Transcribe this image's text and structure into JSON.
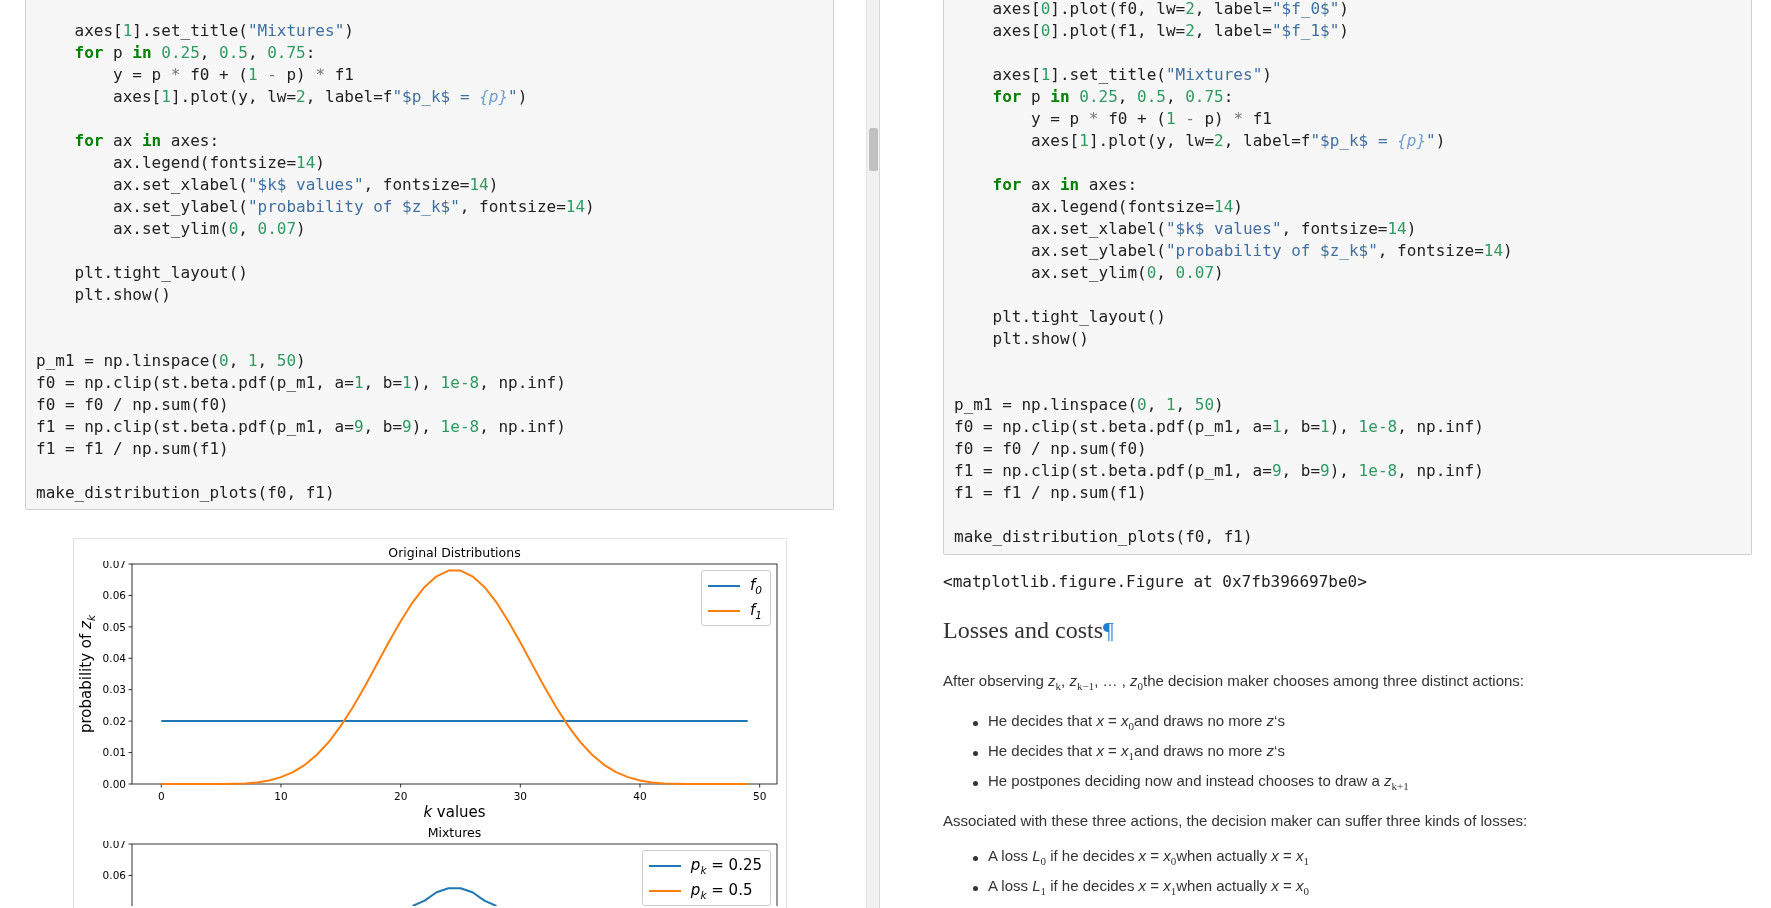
{
  "left_pane": {
    "code_cell": {
      "lines": [
        {
          "kind": "code",
          "tokens": [
            {
              "text": "    axes[",
              "kind": "plain"
            },
            {
              "text": "1",
              "kind": "num"
            },
            {
              "text": "].set_title(",
              "kind": "plain"
            },
            {
              "text": "\"Mixtures\"",
              "kind": "str"
            },
            {
              "text": ")",
              "kind": "plain"
            }
          ]
        },
        {
          "kind": "code",
          "tokens": [
            {
              "text": "    for",
              "kind": "kw"
            },
            {
              "text": " p ",
              "kind": "plain"
            },
            {
              "text": "in",
              "kind": "kw"
            },
            {
              "text": " 0.25",
              "kind": "num"
            },
            {
              "text": ", ",
              "kind": "plain"
            },
            {
              "text": "0.5",
              "kind": "num"
            },
            {
              "text": ", ",
              "kind": "plain"
            },
            {
              "text": "0.75",
              "kind": "num"
            },
            {
              "text": ":",
              "kind": "plain"
            }
          ]
        },
        {
          "kind": "code",
          "tokens": [
            {
              "text": "        y = p ",
              "kind": "plain"
            },
            {
              "text": "*",
              "kind": "op"
            },
            {
              "text": " f0 + (",
              "kind": "plain"
            },
            {
              "text": "1",
              "kind": "num"
            },
            {
              "text": " -",
              "kind": "op"
            },
            {
              "text": " p) ",
              "kind": "plain"
            },
            {
              "text": "*",
              "kind": "op"
            },
            {
              "text": " f1",
              "kind": "plain"
            }
          ]
        },
        {
          "kind": "code",
          "tokens": [
            {
              "text": "        axes[",
              "kind": "plain"
            },
            {
              "text": "1",
              "kind": "num"
            },
            {
              "text": "].plot(y, lw=",
              "kind": "plain"
            },
            {
              "text": "2",
              "kind": "num"
            },
            {
              "text": ", label=f",
              "kind": "plain"
            },
            {
              "text": "\"$p_k$ = ",
              "kind": "str"
            },
            {
              "text": "{p}",
              "kind": "interp"
            },
            {
              "text": "\"",
              "kind": "str"
            },
            {
              "text": ")",
              "kind": "plain"
            }
          ]
        },
        {
          "kind": "blank"
        },
        {
          "kind": "code",
          "tokens": [
            {
              "text": "    for",
              "kind": "kw"
            },
            {
              "text": " ax ",
              "kind": "plain"
            },
            {
              "text": "in",
              "kind": "kw"
            },
            {
              "text": " axes:",
              "kind": "plain"
            }
          ]
        },
        {
          "kind": "code",
          "tokens": [
            {
              "text": "        ax.legend(fontsize=",
              "kind": "plain"
            },
            {
              "text": "14",
              "kind": "num"
            },
            {
              "text": ")",
              "kind": "plain"
            }
          ]
        },
        {
          "kind": "code",
          "tokens": [
            {
              "text": "        ax.set_xlabel(",
              "kind": "plain"
            },
            {
              "text": "\"$k$ values\"",
              "kind": "str"
            },
            {
              "text": ", fontsize=",
              "kind": "plain"
            },
            {
              "text": "14",
              "kind": "num"
            },
            {
              "text": ")",
              "kind": "plain"
            }
          ]
        },
        {
          "kind": "code",
          "tokens": [
            {
              "text": "        ax.set_ylabel(",
              "kind": "plain"
            },
            {
              "text": "\"probability of $z_k$\"",
              "kind": "str"
            },
            {
              "text": ", fontsize=",
              "kind": "plain"
            },
            {
              "text": "14",
              "kind": "num"
            },
            {
              "text": ")",
              "kind": "plain"
            }
          ]
        },
        {
          "kind": "code",
          "tokens": [
            {
              "text": "        ax.set_ylim(",
              "kind": "plain"
            },
            {
              "text": "0",
              "kind": "num"
            },
            {
              "text": ", ",
              "kind": "plain"
            },
            {
              "text": "0.07",
              "kind": "num"
            },
            {
              "text": ")",
              "kind": "plain"
            }
          ]
        },
        {
          "kind": "blank"
        },
        {
          "kind": "code",
          "tokens": [
            {
              "text": "    plt.tight_layout()",
              "kind": "plain"
            }
          ]
        },
        {
          "kind": "code",
          "tokens": [
            {
              "text": "    plt.show()",
              "kind": "plain"
            }
          ]
        },
        {
          "kind": "blank"
        },
        {
          "kind": "blank"
        },
        {
          "kind": "code",
          "tokens": [
            {
              "text": "p_m1 = np.linspace(",
              "kind": "plain"
            },
            {
              "text": "0",
              "kind": "num"
            },
            {
              "text": ", ",
              "kind": "plain"
            },
            {
              "text": "1",
              "kind": "num"
            },
            {
              "text": ", ",
              "kind": "plain"
            },
            {
              "text": "50",
              "kind": "num"
            },
            {
              "text": ")",
              "kind": "plain"
            }
          ]
        },
        {
          "kind": "code",
          "tokens": [
            {
              "text": "f0 = np.clip(st.beta.pdf(p_m1, a=",
              "kind": "plain"
            },
            {
              "text": "1",
              "kind": "num"
            },
            {
              "text": ", b=",
              "kind": "plain"
            },
            {
              "text": "1",
              "kind": "num"
            },
            {
              "text": "), ",
              "kind": "plain"
            },
            {
              "text": "1e-8",
              "kind": "num"
            },
            {
              "text": ", np.inf)",
              "kind": "plain"
            }
          ]
        },
        {
          "kind": "code",
          "tokens": [
            {
              "text": "f0 = f0 / np.sum(f0)",
              "kind": "plain"
            }
          ]
        },
        {
          "kind": "code",
          "tokens": [
            {
              "text": "f1 = np.clip(st.beta.pdf(p_m1, a=",
              "kind": "plain"
            },
            {
              "text": "9",
              "kind": "num"
            },
            {
              "text": ", b=",
              "kind": "plain"
            },
            {
              "text": "9",
              "kind": "num"
            },
            {
              "text": "), ",
              "kind": "plain"
            },
            {
              "text": "1e-8",
              "kind": "num"
            },
            {
              "text": ", np.inf)",
              "kind": "plain"
            }
          ]
        },
        {
          "kind": "code",
          "tokens": [
            {
              "text": "f1 = f1 / np.sum(f1)",
              "kind": "plain"
            }
          ]
        },
        {
          "kind": "blank"
        },
        {
          "kind": "code",
          "tokens": [
            {
              "text": "make_distribution_plots(f0, f1)",
              "kind": "plain"
            }
          ]
        }
      ]
    },
    "output": {
      "charts": [
        {
          "chart_data": {
            "type": "line",
            "title": "Original Distributions",
            "xlabel": "*k* values",
            "ylabel": "probability of *z*$_{k}$",
            "x": [
              0,
              1,
              2,
              3,
              4,
              5,
              6,
              7,
              8,
              9,
              10,
              11,
              12,
              13,
              14,
              15,
              16,
              17,
              18,
              19,
              20,
              21,
              22,
              23,
              24,
              25,
              26,
              27,
              28,
              29,
              30,
              31,
              32,
              33,
              34,
              35,
              36,
              37,
              38,
              39,
              40,
              41,
              42,
              43,
              44,
              45,
              46,
              47,
              48,
              49
            ],
            "series": [
              {
                "name": "*f*$_{0}$",
                "color": "#1f77b4",
                "values": [
                  0.02,
                  0.02,
                  0.02,
                  0.02,
                  0.02,
                  0.02,
                  0.02,
                  0.02,
                  0.02,
                  0.02,
                  0.02,
                  0.02,
                  0.02,
                  0.02,
                  0.02,
                  0.02,
                  0.02,
                  0.02,
                  0.02,
                  0.02,
                  0.02,
                  0.02,
                  0.02,
                  0.02,
                  0.02,
                  0.02,
                  0.02,
                  0.02,
                  0.02,
                  0.02,
                  0.02,
                  0.02,
                  0.02,
                  0.02,
                  0.02,
                  0.02,
                  0.02,
                  0.02,
                  0.02,
                  0.02,
                  0.02,
                  0.02,
                  0.02,
                  0.02,
                  0.02,
                  0.02,
                  0.02,
                  0.02,
                  0.02,
                  0.02
                ]
              },
              {
                "name": "*f*$_{1}$",
                "color": "#ff7f0e",
                "values": [
                  0,
                  0,
                  0,
                  0,
                  0,
                  0,
                  0.0001,
                  0.0002,
                  0.0005,
                  0.0011,
                  0.0022,
                  0.0038,
                  0.0061,
                  0.0093,
                  0.0134,
                  0.0185,
                  0.0244,
                  0.031,
                  0.038,
                  0.0451,
                  0.0518,
                  0.0578,
                  0.0627,
                  0.0661,
                  0.0679,
                  0.0679,
                  0.0661,
                  0.0627,
                  0.0578,
                  0.0518,
                  0.0451,
                  0.038,
                  0.031,
                  0.0244,
                  0.0185,
                  0.0134,
                  0.0093,
                  0.0061,
                  0.0038,
                  0.0022,
                  0.0011,
                  0.0005,
                  0.0002,
                  0.0001,
                  0,
                  0,
                  0,
                  0,
                  0,
                  0
                ]
              }
            ],
            "xlim": [
              -2.45,
              51.45
            ],
            "ylim": [
              0,
              0.07
            ],
            "xticks": [
              0,
              10,
              20,
              30,
              40,
              50
            ],
            "yticks": [
              {
                "value": 0,
                "label": "0.00"
              },
              {
                "value": 0.01,
                "label": "0.01"
              },
              {
                "value": 0.02,
                "label": "0.02"
              },
              {
                "value": 0.03,
                "label": "0.03"
              },
              {
                "value": 0.04,
                "label": "0.04"
              },
              {
                "value": 0.05,
                "label": "0.05"
              },
              {
                "value": 0.06,
                "label": "0.06"
              },
              {
                "value": 0.07,
                "label": "0.07"
              }
            ],
            "legend": "upper right"
          }
        },
        {
          "title": "Mixtures",
          "y_tick_labels": [
            "0.07",
            "0.06"
          ],
          "legend_entries": [
            {
              "label": "*p*$_{k}$ = 0.25",
              "color": "#1f77b4"
            },
            {
              "label": "*p*$_{k}$ = 0.5",
              "color": "#ff7f0e"
            }
          ]
        }
      ]
    }
  },
  "right_pane": {
    "code_cell": {
      "lines": [
        {
          "kind": "code",
          "tokens": [
            {
              "text": "    axes[",
              "kind": "plain"
            },
            {
              "text": "0",
              "kind": "num"
            },
            {
              "text": "].plot(f0, lw=",
              "kind": "plain"
            },
            {
              "text": "2",
              "kind": "num"
            },
            {
              "text": ", label=",
              "kind": "plain"
            },
            {
              "text": "\"$f_0$\"",
              "kind": "str"
            },
            {
              "text": ")",
              "kind": "plain"
            }
          ]
        },
        {
          "kind": "code",
          "tokens": [
            {
              "text": "    axes[",
              "kind": "plain"
            },
            {
              "text": "0",
              "kind": "num"
            },
            {
              "text": "].plot(f1, lw=",
              "kind": "plain"
            },
            {
              "text": "2",
              "kind": "num"
            },
            {
              "text": ", label=",
              "kind": "plain"
            },
            {
              "text": "\"$f_1$\"",
              "kind": "str"
            },
            {
              "text": ")",
              "kind": "plain"
            }
          ]
        },
        {
          "kind": "blank"
        },
        {
          "kind": "code",
          "tokens": [
            {
              "text": "    axes[",
              "kind": "plain"
            },
            {
              "text": "1",
              "kind": "num"
            },
            {
              "text": "].set_title(",
              "kind": "plain"
            },
            {
              "text": "\"Mixtures\"",
              "kind": "str"
            },
            {
              "text": ")",
              "kind": "plain"
            }
          ]
        },
        {
          "kind": "code",
          "tokens": [
            {
              "text": "    for",
              "kind": "kw"
            },
            {
              "text": " p ",
              "kind": "plain"
            },
            {
              "text": "in",
              "kind": "kw"
            },
            {
              "text": " 0.25",
              "kind": "num"
            },
            {
              "text": ", ",
              "kind": "plain"
            },
            {
              "text": "0.5",
              "kind": "num"
            },
            {
              "text": ", ",
              "kind": "plain"
            },
            {
              "text": "0.75",
              "kind": "num"
            },
            {
              "text": ":",
              "kind": "plain"
            }
          ]
        },
        {
          "kind": "code",
          "tokens": [
            {
              "text": "        y = p ",
              "kind": "plain"
            },
            {
              "text": "*",
              "kind": "op"
            },
            {
              "text": " f0 + (",
              "kind": "plain"
            },
            {
              "text": "1",
              "kind": "num"
            },
            {
              "text": " -",
              "kind": "op"
            },
            {
              "text": " p) ",
              "kind": "plain"
            },
            {
              "text": "*",
              "kind": "op"
            },
            {
              "text": " f1",
              "kind": "plain"
            }
          ]
        },
        {
          "kind": "code",
          "tokens": [
            {
              "text": "        axes[",
              "kind": "plain"
            },
            {
              "text": "1",
              "kind": "num"
            },
            {
              "text": "].plot(y, lw=",
              "kind": "plain"
            },
            {
              "text": "2",
              "kind": "num"
            },
            {
              "text": ", label=f",
              "kind": "plain"
            },
            {
              "text": "\"$p_k$ = ",
              "kind": "str"
            },
            {
              "text": "{p}",
              "kind": "interp"
            },
            {
              "text": "\"",
              "kind": "str"
            },
            {
              "text": ")",
              "kind": "plain"
            }
          ]
        },
        {
          "kind": "blank"
        },
        {
          "kind": "code",
          "tokens": [
            {
              "text": "    for",
              "kind": "kw"
            },
            {
              "text": " ax ",
              "kind": "plain"
            },
            {
              "text": "in",
              "kind": "kw"
            },
            {
              "text": " axes:",
              "kind": "plain"
            }
          ]
        },
        {
          "kind": "code",
          "tokens": [
            {
              "text": "        ax.legend(fontsize=",
              "kind": "plain"
            },
            {
              "text": "14",
              "kind": "num"
            },
            {
              "text": ")",
              "kind": "plain"
            }
          ]
        },
        {
          "kind": "code",
          "tokens": [
            {
              "text": "        ax.set_xlabel(",
              "kind": "plain"
            },
            {
              "text": "\"$k$ values\"",
              "kind": "str"
            },
            {
              "text": ", fontsize=",
              "kind": "plain"
            },
            {
              "text": "14",
              "kind": "num"
            },
            {
              "text": ")",
              "kind": "plain"
            }
          ]
        },
        {
          "kind": "code",
          "tokens": [
            {
              "text": "        ax.set_ylabel(",
              "kind": "plain"
            },
            {
              "text": "\"probability of $z_k$\"",
              "kind": "str"
            },
            {
              "text": ", fontsize=",
              "kind": "plain"
            },
            {
              "text": "14",
              "kind": "num"
            },
            {
              "text": ")",
              "kind": "plain"
            }
          ]
        },
        {
          "kind": "code",
          "tokens": [
            {
              "text": "        ax.set_ylim(",
              "kind": "plain"
            },
            {
              "text": "0",
              "kind": "num"
            },
            {
              "text": ", ",
              "kind": "plain"
            },
            {
              "text": "0.07",
              "kind": "num"
            },
            {
              "text": ")",
              "kind": "plain"
            }
          ]
        },
        {
          "kind": "blank"
        },
        {
          "kind": "code",
          "tokens": [
            {
              "text": "    plt.tight_layout()",
              "kind": "plain"
            }
          ]
        },
        {
          "kind": "code",
          "tokens": [
            {
              "text": "    plt.show()",
              "kind": "plain"
            }
          ]
        },
        {
          "kind": "blank"
        },
        {
          "kind": "blank"
        },
        {
          "kind": "code",
          "tokens": [
            {
              "text": "p_m1 = np.linspace(",
              "kind": "plain"
            },
            {
              "text": "0",
              "kind": "num"
            },
            {
              "text": ", ",
              "kind": "plain"
            },
            {
              "text": "1",
              "kind": "num"
            },
            {
              "text": ", ",
              "kind": "plain"
            },
            {
              "text": "50",
              "kind": "num"
            },
            {
              "text": ")",
              "kind": "plain"
            }
          ]
        },
        {
          "kind": "code",
          "tokens": [
            {
              "text": "f0 = np.clip(st.beta.pdf(p_m1, a=",
              "kind": "plain"
            },
            {
              "text": "1",
              "kind": "num"
            },
            {
              "text": ", b=",
              "kind": "plain"
            },
            {
              "text": "1",
              "kind": "num"
            },
            {
              "text": "), ",
              "kind": "plain"
            },
            {
              "text": "1e-8",
              "kind": "num"
            },
            {
              "text": ", np.inf)",
              "kind": "plain"
            }
          ]
        },
        {
          "kind": "code",
          "tokens": [
            {
              "text": "f0 = f0 / np.sum(f0)",
              "kind": "plain"
            }
          ]
        },
        {
          "kind": "code",
          "tokens": [
            {
              "text": "f1 = np.clip(st.beta.pdf(p_m1, a=",
              "kind": "plain"
            },
            {
              "text": "9",
              "kind": "num"
            },
            {
              "text": ", b=",
              "kind": "plain"
            },
            {
              "text": "9",
              "kind": "num"
            },
            {
              "text": "), ",
              "kind": "plain"
            },
            {
              "text": "1e-8",
              "kind": "num"
            },
            {
              "text": ", np.inf)",
              "kind": "plain"
            }
          ]
        },
        {
          "kind": "code",
          "tokens": [
            {
              "text": "f1 = f1 / np.sum(f1)",
              "kind": "plain"
            }
          ]
        },
        {
          "kind": "blank"
        },
        {
          "kind": "code",
          "tokens": [
            {
              "text": "make_distribution_plots(f0, f1)",
              "kind": "plain"
            }
          ]
        }
      ]
    },
    "output_text": "<matplotlib.figure.Figure at 0x7fb396697be0>",
    "heading": {
      "text": "Losses and costs",
      "anchor": "¶"
    },
    "blocks": [
      {
        "kind": "paragraph",
        "text": "After observing *z*$_{k}$, *z*$_{k−1}$, … , *z*$_{0}$the decision maker chooses among three distinct actions:"
      },
      {
        "kind": "list",
        "items": [
          "He decides that *x* = *x*$_{0}$and draws no more *z*‘s",
          "He decides that *x* = *x*$_{1}$and draws no more *z*‘s",
          "He postpones deciding now and instead chooses to draw a *z*$_{k+1}$"
        ]
      },
      {
        "kind": "paragraph",
        "text": "Associated with these three actions, the decision maker can suffer three kinds of losses:"
      },
      {
        "kind": "list",
        "items": [
          "A loss *L*$_{0}$ if he decides *x* = *x*$_{0}$when actually *x* = *x*$_{1}$",
          "A loss *L*$_{1}$ if he decides *x* = *x*$_{1}$when actually *x* = *x*$_{0}$"
        ]
      }
    ]
  }
}
